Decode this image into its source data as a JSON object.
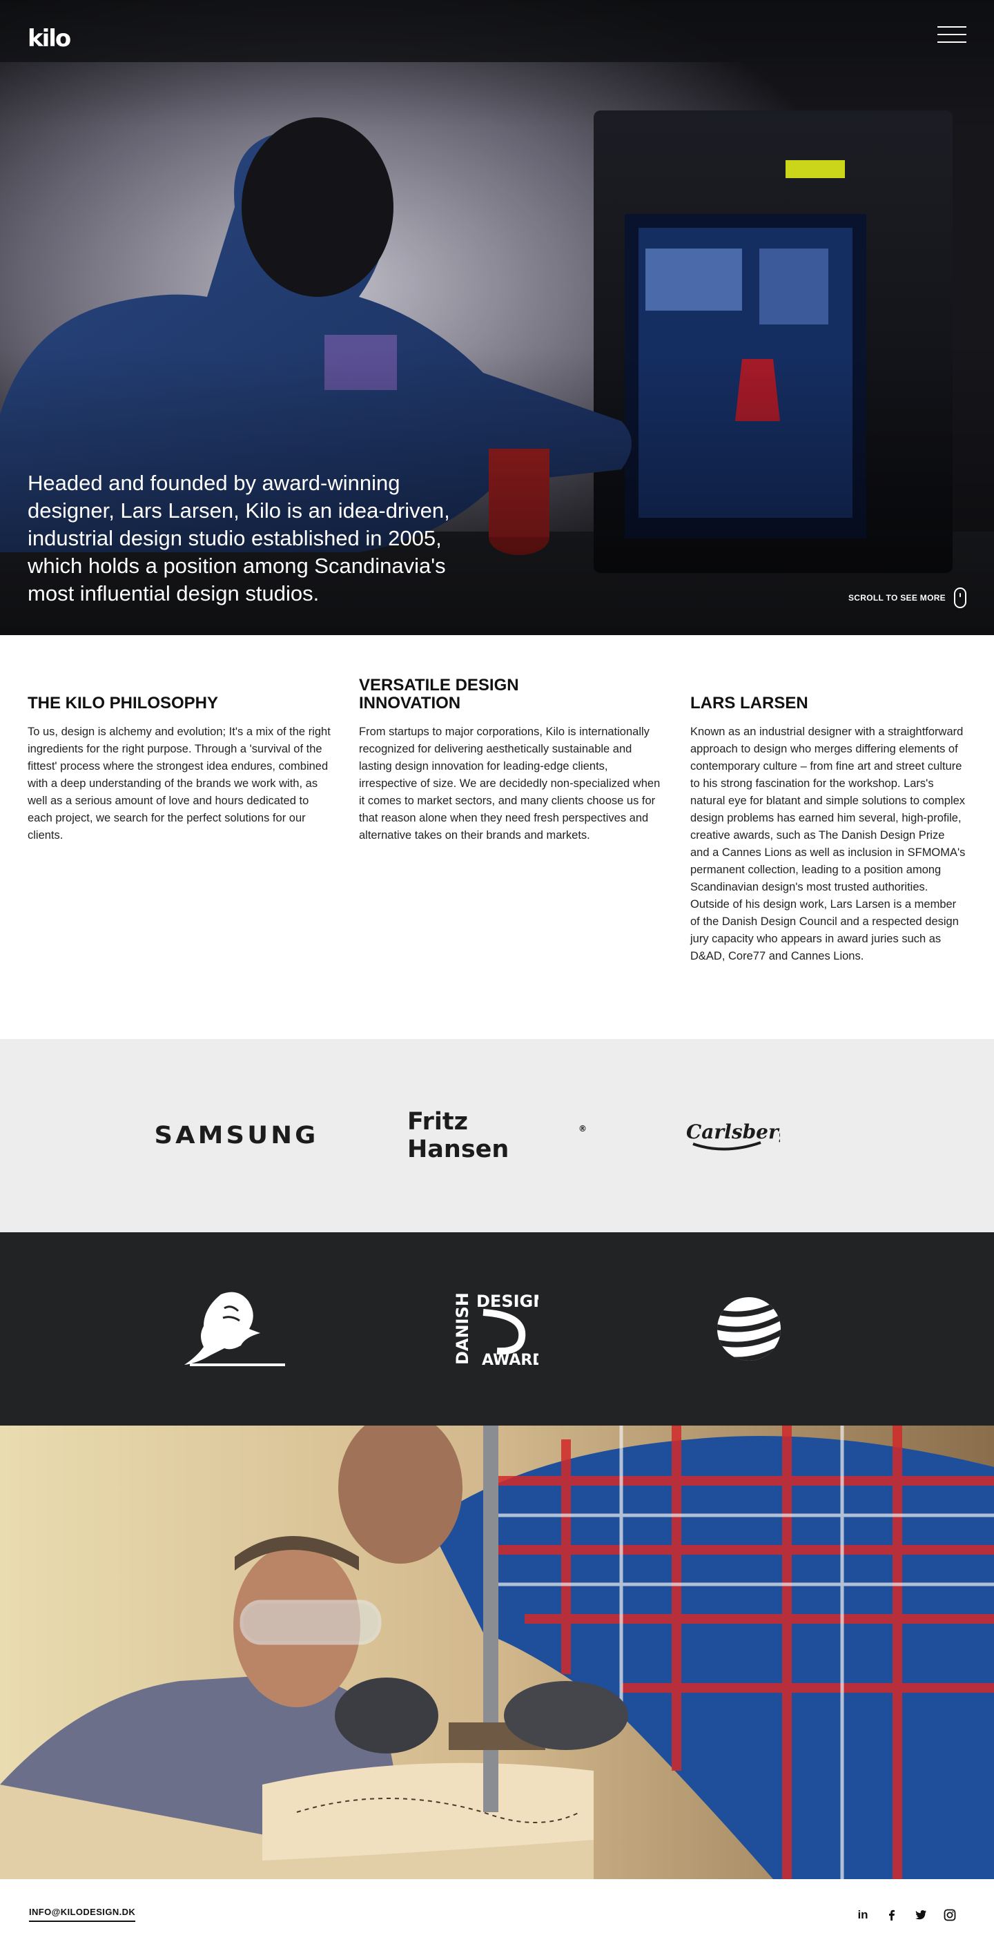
{
  "header": {
    "logo_text": "kilo",
    "menu_icon": "hamburger-icon"
  },
  "hero": {
    "intro": "Headed and founded by award-winning designer, Lars Larsen, Kilo is an idea-driven, industrial design studio established in 2005, which holds a position among Scandinavia's most influential design studios.",
    "scroll_label": "SCROLL TO SEE MORE",
    "scroll_icon": "mouse-scroll-icon"
  },
  "columns": [
    {
      "title": "THE KILO PHILOSOPHY",
      "body": "To us, design is alchemy and evolution; It's a mix of the right ingredients for the right purpose. Through a 'survival of the fittest' process where the strongest idea endures, combined with a deep understanding of the brands we work with, as well as a serious amount of love and hours dedicated to each project, we search for the perfect solutions for our clients."
    },
    {
      "title": "VERSATILE DESIGN INNOVATION",
      "body": "From startups to major corporations, Kilo is internationally recognized for delivering aesthetically sustainable and lasting design innovation for leading-edge clients, irrespective of size. We are decidedly non-specialized when it comes to market sectors, and many clients choose us for that reason alone when they need fresh perspectives and alternative takes on their brands and markets."
    },
    {
      "title": "LARS LARSEN",
      "body": "Known as an industrial designer with a straightforward approach to design who merges differing elements of contemporary culture – from fine art and street culture to his strong fascination for the workshop. Lars's natural eye for blatant and simple solutions to complex design problems has earned him several, high-profile, creative awards, such as The Danish Design Prize and a Cannes Lions as well as inclusion in SFMOMA's permanent collection, leading to a position among Scandinavian design's most trusted authorities. Outside of his design work, Lars Larsen is a member of the Danish Design Council and a respected design jury capacity who appears in award juries such as D&AD, Core77 and Cannes Lions."
    }
  ],
  "clients": {
    "samsung": "SAMSUNG",
    "fritz_hansen": "Fritz Hansen",
    "fritz_mark": "®",
    "carlsberg": "Carlsberg"
  },
  "awards": {
    "lion_icon": "cannes-lions-logo",
    "danish_top": "DESIGN",
    "danish_side": "DANISH",
    "danish_bottom": "AWARD",
    "globe_icon": "striped-globe-logo"
  },
  "footer": {
    "email": "INFO@KILODESIGN.DK",
    "socials": [
      "linkedin-icon",
      "facebook-icon",
      "twitter-icon",
      "instagram-icon"
    ]
  },
  "colors": {
    "hero_bg": "#0f1014",
    "clients_bg": "#ededee",
    "awards_bg": "#222325",
    "text": "#1a1a1a"
  }
}
